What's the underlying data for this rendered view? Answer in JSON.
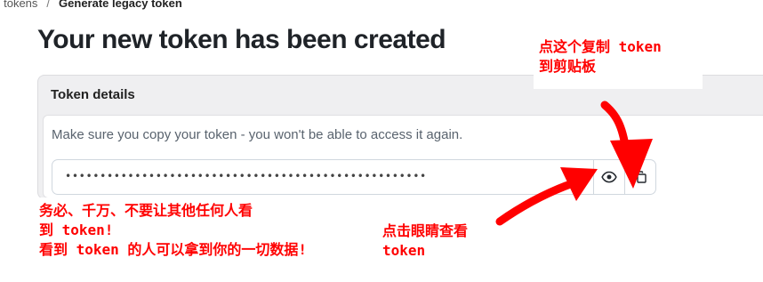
{
  "breadcrumb": {
    "parent": "s tokens",
    "separator": "/",
    "current": "Generate legacy token"
  },
  "page_title": "Your new token has been created",
  "token_card": {
    "header": "Token details",
    "description": "Make sure you copy your token - you won't be able to access it again.",
    "masked_token": "••••••••••••••••••••••••••••••••••••••••••••••••••••"
  },
  "icons": {
    "show": "eye-icon",
    "copy": "copy-icon"
  },
  "annotations": {
    "copy_hint": [
      "点这个复制 token",
      "到剪贴板"
    ],
    "warning": [
      "务必、千万、不要让其他任何人看",
      "到 token!",
      "看到 token 的人可以拿到你的一切数据!"
    ],
    "view_hint": [
      "点击眼睛查看",
      "token"
    ],
    "color": "#ff0000"
  }
}
